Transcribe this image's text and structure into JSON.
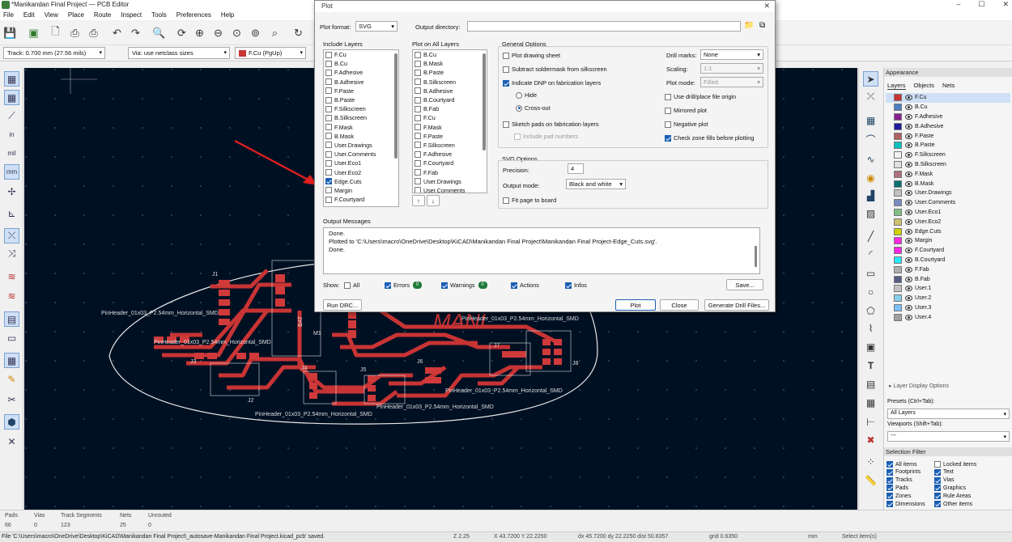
{
  "window": {
    "title": "*Manikandan Final Project — PCB Editor"
  },
  "menu": [
    "File",
    "Edit",
    "View",
    "Place",
    "Route",
    "Inspect",
    "Tools",
    "Preferences",
    "Help"
  ],
  "aux": {
    "track": "Track: 0.700 mm (27.56 mils)",
    "via": "Via: use netclass sizes",
    "layer": "F.Cu (PgUp)",
    "layer_color": "#c83434"
  },
  "dialog": {
    "title": "Plot",
    "plot_format_label": "Plot format:",
    "plot_format": "SVG",
    "output_dir_label": "Output directory:",
    "output_dir": "",
    "include_layers_label": "Include Layers",
    "include_layers": [
      {
        "name": "F.Cu",
        "on": false
      },
      {
        "name": "B.Cu",
        "on": false
      },
      {
        "name": "F.Adhesive",
        "on": false
      },
      {
        "name": "B.Adhesive",
        "on": false
      },
      {
        "name": "F.Paste",
        "on": false
      },
      {
        "name": "B.Paste",
        "on": false
      },
      {
        "name": "F.Silkscreen",
        "on": false
      },
      {
        "name": "B.Silkscreen",
        "on": false
      },
      {
        "name": "F.Mask",
        "on": false
      },
      {
        "name": "B.Mask",
        "on": false
      },
      {
        "name": "User.Drawings",
        "on": false
      },
      {
        "name": "User.Comments",
        "on": false
      },
      {
        "name": "User.Eco1",
        "on": false
      },
      {
        "name": "User.Eco2",
        "on": false
      },
      {
        "name": "Edge.Cuts",
        "on": true
      },
      {
        "name": "Margin",
        "on": false
      },
      {
        "name": "F.Courtyard",
        "on": false
      }
    ],
    "plot_all_label": "Plot on All Layers",
    "plot_all_layers": [
      {
        "name": "B.Cu",
        "on": false
      },
      {
        "name": "B.Mask",
        "on": false
      },
      {
        "name": "B.Paste",
        "on": false
      },
      {
        "name": "B.Silkscreen",
        "on": false
      },
      {
        "name": "B.Adhesive",
        "on": false
      },
      {
        "name": "B.Courtyard",
        "on": false
      },
      {
        "name": "B.Fab",
        "on": false
      },
      {
        "name": "F.Cu",
        "on": false
      },
      {
        "name": "F.Mask",
        "on": false
      },
      {
        "name": "F.Paste",
        "on": false
      },
      {
        "name": "F.Silkscreen",
        "on": false
      },
      {
        "name": "F.Adhesive",
        "on": false
      },
      {
        "name": "F.Courtyard",
        "on": false
      },
      {
        "name": "F.Fab",
        "on": false
      },
      {
        "name": "User.Drawings",
        "on": false
      },
      {
        "name": "User.Comments",
        "on": false
      }
    ],
    "general_label": "General Options",
    "opt_plot_drawing_sheet": "Plot drawing sheet",
    "opt_subtract_soldermask": "Subtract soldermask from silkscreen",
    "opt_indicate_dnp": "Indicate DNP on fabrication layers",
    "opt_hide": "Hide",
    "opt_crossout": "Cross-out",
    "opt_sketch_pads": "Sketch pads on fabrication layers",
    "opt_include_pad_numbers": "Include pad numbers",
    "drill_marks_label": "Drill marks:",
    "drill_marks": "None",
    "scaling_label": "Scaling:",
    "scaling": "1:1",
    "plot_mode_label": "Plot mode:",
    "plot_mode": "Filled",
    "opt_drill_origin": "Use drill/place file origin",
    "opt_mirrored": "Mirrored plot",
    "opt_negative": "Negative plot",
    "opt_check_zone": "Check zone fills before plotting",
    "svg_options_label": "SVG Options",
    "precision_label": "Precision:",
    "precision": "4",
    "output_mode_label": "Output mode:",
    "output_mode": "Black and white",
    "opt_fit_page": "Fit page to board",
    "output_messages_label": "Output Messages",
    "messages": [
      "Done.",
      "Plotted to 'C:\\Users\\macro\\OneDrive\\Desktop\\KiCAD\\Manikandan Final Project\\Manikandan Final Project-Edge_Cuts.svg'.",
      "Done."
    ],
    "show_label": "Show:",
    "show_all": "All",
    "show_errors": "Errors",
    "errors_count": "0",
    "show_warnings": "Warnings",
    "warnings_count": "0",
    "show_actions": "Actions",
    "show_infos": "Infos",
    "save_btn": "Save...",
    "run_drc_btn": "Run DRC...",
    "plot_btn": "Plot",
    "close_btn": "Close",
    "gen_drill_btn": "Generate Drill Files..."
  },
  "pcb": {
    "labels": [
      "PinHeader_01x03_P2.54mm_Horizontal_SMD",
      "PinHeader_01x03_P2.54mm_Horizontal_SMD",
      "PinHeader_01x03_P2.54mm_Horizontal_SMD",
      "PinHeader_01x03_P2.54mm_Horizontal_SMD",
      "PinHeader_01x03_P2.54mm_Horizontal_SMD",
      "PinHeader_01x03_P2.54mm_Horizontal_SMD"
    ],
    "refs": [
      "J1",
      "J2",
      "J3",
      "J4",
      "J5",
      "J6",
      "J7",
      "J8",
      "M1",
      "BAT"
    ],
    "silk_text": "MANI"
  },
  "appearance": {
    "title": "Appearance",
    "tabs": [
      "Layers",
      "Objects",
      "Nets"
    ],
    "layers": [
      {
        "name": "F.Cu",
        "color": "#c83434"
      },
      {
        "name": "B.Cu",
        "color": "#4d7fc4"
      },
      {
        "name": "F.Adhesive",
        "color": "#8a2090"
      },
      {
        "name": "B.Adhesive",
        "color": "#1e1ea0"
      },
      {
        "name": "F.Paste",
        "color": "#b06060"
      },
      {
        "name": "B.Paste",
        "color": "#00c2c2"
      },
      {
        "name": "F.Silkscreen",
        "color": "#f0f0f0"
      },
      {
        "name": "B.Silkscreen",
        "color": "#e0e0e0"
      },
      {
        "name": "F.Mask",
        "color": "#b07080"
      },
      {
        "name": "B.Mask",
        "color": "#0a7070"
      },
      {
        "name": "User.Drawings",
        "color": "#c2c2c2"
      },
      {
        "name": "User.Comments",
        "color": "#7a8cc2"
      },
      {
        "name": "User.Eco1",
        "color": "#80c080"
      },
      {
        "name": "User.Eco2",
        "color": "#d0c070"
      },
      {
        "name": "Edge.Cuts",
        "color": "#d0d200"
      },
      {
        "name": "Margin",
        "color": "#ff26e2"
      },
      {
        "name": "F.Courtyard",
        "color": "#ff26e2"
      },
      {
        "name": "B.Courtyard",
        "color": "#26e9ff"
      },
      {
        "name": "F.Fab",
        "color": "#afafaf"
      },
      {
        "name": "B.Fab",
        "color": "#585d84"
      },
      {
        "name": "User.1",
        "color": "#c2c2c2"
      },
      {
        "name": "User.2",
        "color": "#89cff0"
      },
      {
        "name": "User.3",
        "color": "#7ac0ff"
      },
      {
        "name": "User.4",
        "color": "#a0a0a0"
      }
    ],
    "layer_display_options": "Layer Display Options",
    "presets_label": "Presets (Ctrl+Tab):",
    "presets": "All Layers",
    "viewports_label": "Viewports (Shift+Tab):",
    "viewports": "---",
    "selection_filter": "Selection Filter",
    "filter": [
      {
        "name": "All items",
        "on": true
      },
      {
        "name": "Locked items",
        "on": false
      },
      {
        "name": "Footprints",
        "on": true
      },
      {
        "name": "Text",
        "on": true
      },
      {
        "name": "Tracks",
        "on": true
      },
      {
        "name": "Vias",
        "on": true
      },
      {
        "name": "Pads",
        "on": true
      },
      {
        "name": "Graphics",
        "on": true
      },
      {
        "name": "Zones",
        "on": true
      },
      {
        "name": "Rule Areas",
        "on": true
      },
      {
        "name": "Dimensions",
        "on": true
      },
      {
        "name": "Other items",
        "on": true
      }
    ]
  },
  "status": {
    "headers": [
      "Pads",
      "Vias",
      "Track Segments",
      "Nets",
      "Unrouted"
    ],
    "values": [
      "66",
      "0",
      "123",
      "25",
      "0"
    ],
    "message": "File 'C:\\Users\\macro\\OneDrive\\Desktop\\KiCAD\\Manikandan Final Project\\_autosave-Manikandan Final Project.kicad_pcb' saved.",
    "zoom": "Z 2.25",
    "xy": "X 43.7200  Y 22.2250",
    "dxy": "dx 45.7200  dy 22.2250  dist 50.8357",
    "grid": "grid 0.6350",
    "units": "mm",
    "mode": "Select item(s)"
  }
}
